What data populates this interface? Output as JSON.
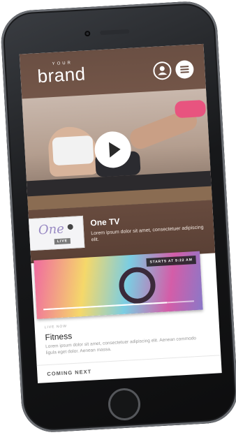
{
  "header": {
    "brand_small": "YOUR",
    "brand_big": "brand",
    "user_icon": "user-icon",
    "menu_icon": "hamburger-menu-icon"
  },
  "hero_video": {
    "play_icon": "play-icon"
  },
  "channel": {
    "logo_text": "One",
    "logo_badge": "LIVE",
    "title": "One TV",
    "description": "Lorem ipsum dolor sit amet, consectetuer adipiscing elit."
  },
  "live_now": {
    "label": "LIVE NOW",
    "badge": "STARTS AT 9:22 AM",
    "progress": 0.82,
    "title": "Fitness",
    "description": "Lorem ipsum dolor sit amet, consectetuer adipiscing elit. Aenean commodo ligula eget dolor. Aenean massa."
  },
  "coming_next": {
    "label": "COMING NEXT"
  },
  "colors": {
    "hero_bg": "#6a4f43",
    "accent_pink": "#e8547f",
    "phone_body": "#17181a"
  }
}
